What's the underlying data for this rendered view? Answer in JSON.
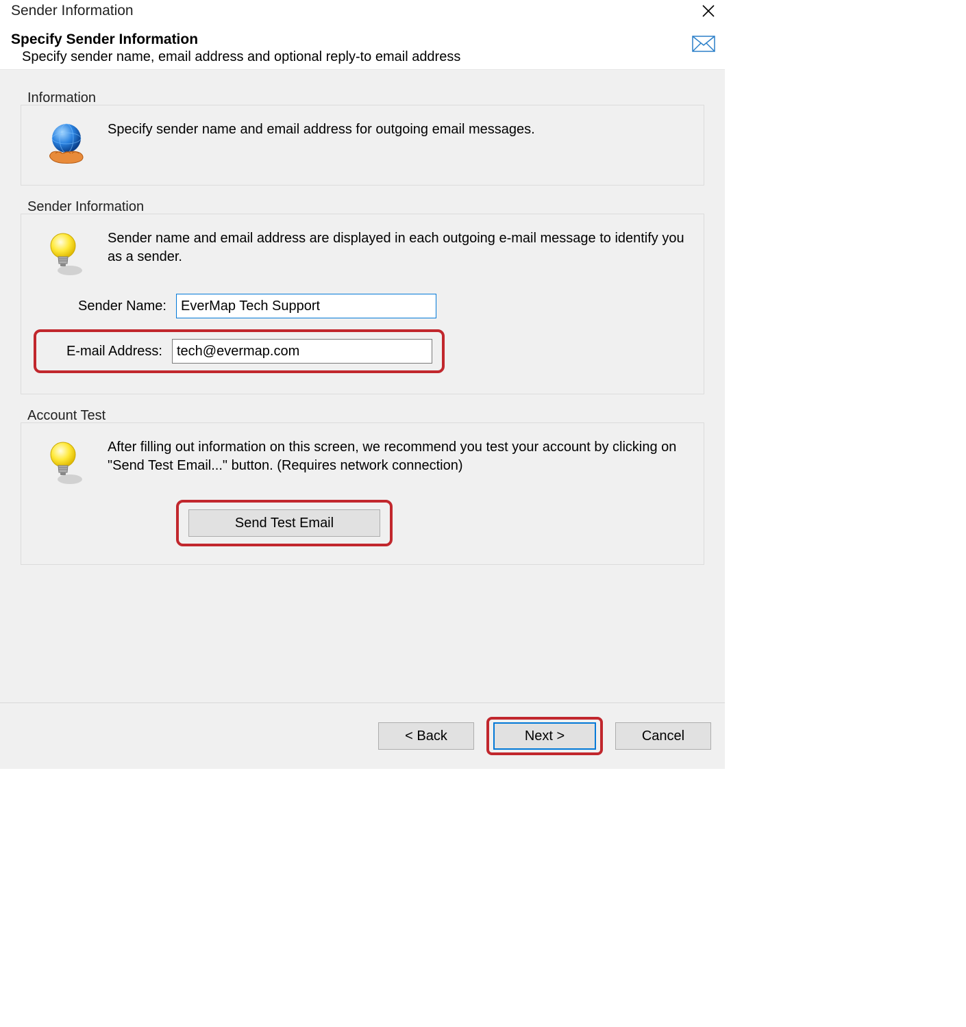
{
  "titlebar": {
    "title": "Sender Information"
  },
  "header": {
    "heading": "Specify Sender Information",
    "subheading": "Specify sender name, email address and optional reply-to email address"
  },
  "information": {
    "legend": "Information",
    "text": "Specify sender name and email address for outgoing email messages."
  },
  "sender": {
    "legend": "Sender Information",
    "text": "Sender name and email address are displayed in each outgoing e-mail message to identify you as a sender.",
    "name_label": "Sender Name:",
    "name_value": "EverMap Tech Support",
    "email_label": "E-mail Address:",
    "email_value": "tech@evermap.com"
  },
  "account_test": {
    "legend": "Account Test",
    "text": "After filling out information on this screen, we recommend you test your account by clicking on \"Send Test Email...\"  button. (Requires network connection)",
    "button_label": "Send Test Email"
  },
  "footer": {
    "back_label": "< Back",
    "next_label": "Next >",
    "cancel_label": "Cancel"
  }
}
